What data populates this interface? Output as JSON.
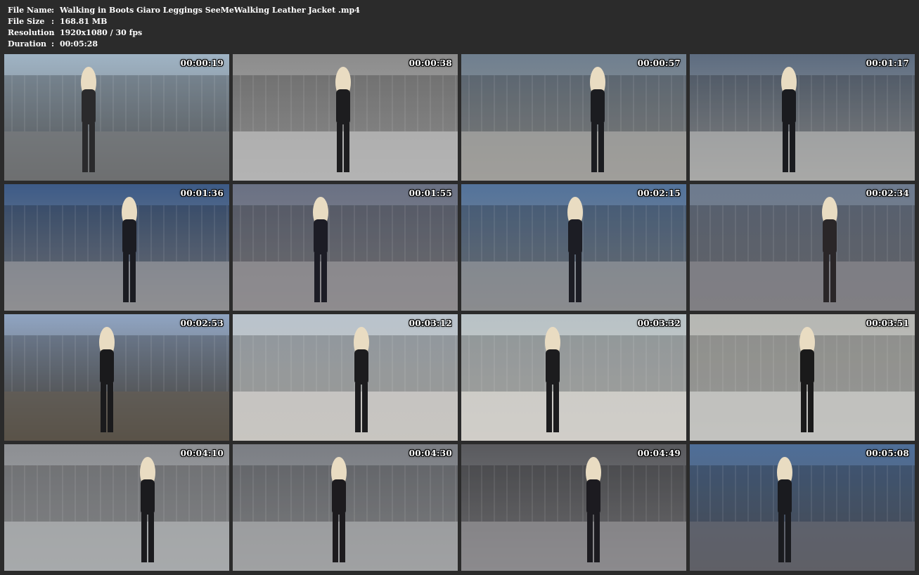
{
  "info": {
    "rows": [
      {
        "label": "File Name",
        "sep": ":",
        "value": "Walking in Boots Giaro Leggings SeeMeWalking Leather Jacket .mp4"
      },
      {
        "label": "File Size",
        "sep": ":",
        "value": "168.81 MB"
      },
      {
        "label": "Resolution",
        "sep": ":",
        "value": "1920x1080 / 30 fps"
      },
      {
        "label": "Duration",
        "sep": ":",
        "value": "00:05:28"
      }
    ]
  },
  "thumbnails": [
    {
      "time": "00:00:19",
      "sky": "#9fb3c4",
      "ground": "#6d6f70",
      "accent": "#2a2a2c"
    },
    {
      "time": "00:00:38",
      "sky": "#8c8c8c",
      "ground": "#b3b3b3",
      "accent": "#1d1d1f"
    },
    {
      "time": "00:00:57",
      "sky": "#6f7f8f",
      "ground": "#a09e9a",
      "accent": "#1b1c20"
    },
    {
      "time": "00:01:17",
      "sky": "#5d6c80",
      "ground": "#a8a8a6",
      "accent": "#1a1b1f"
    },
    {
      "time": "00:01:36",
      "sky": "#3d5b87",
      "ground": "#8f8f92",
      "accent": "#1b1c22"
    },
    {
      "time": "00:01:55",
      "sky": "#6a7184",
      "ground": "#8e8c8e",
      "accent": "#1c1c25"
    },
    {
      "time": "00:02:15",
      "sky": "#53739b",
      "ground": "#8a8c8e",
      "accent": "#1c1d24"
    },
    {
      "time": "00:02:34",
      "sky": "#6d7b8f",
      "ground": "#807f83",
      "accent": "#2a2628"
    },
    {
      "time": "00:02:53",
      "sky": "#8fa4c2",
      "ground": "#5a5348",
      "accent": "#1a1a1c"
    },
    {
      "time": "00:03:12",
      "sky": "#b9c3cc",
      "ground": "#c8c5c0",
      "accent": "#1c1c1e"
    },
    {
      "time": "00:03:32",
      "sky": "#b8c2c6",
      "ground": "#d0cdc8",
      "accent": "#1c1c1e"
    },
    {
      "time": "00:03:51",
      "sky": "#b6b7b3",
      "ground": "#c2c2bf",
      "accent": "#1a1a1a"
    },
    {
      "time": "00:04:10",
      "sky": "#8d8f93",
      "ground": "#a7a9ab",
      "accent": "#1b1b1e"
    },
    {
      "time": "00:04:30",
      "sky": "#7b7e84",
      "ground": "#a0a1a3",
      "accent": "#1d1b1e"
    },
    {
      "time": "00:04:49",
      "sky": "#595a5e",
      "ground": "#8b8a8d",
      "accent": "#1c1b20"
    },
    {
      "time": "00:05:08",
      "sky": "#4e6e98",
      "ground": "#5f6066",
      "accent": "#1a1b1f"
    }
  ]
}
